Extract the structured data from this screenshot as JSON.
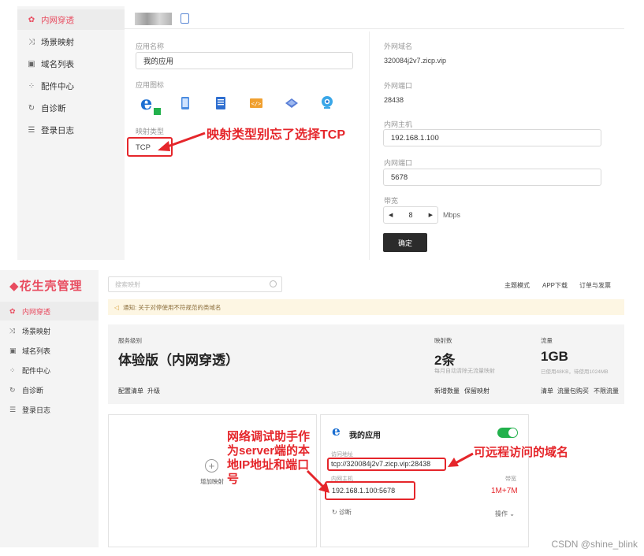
{
  "top": {
    "sidebar": [
      {
        "label": "内网穿透",
        "icon": "globe-icon",
        "active": true
      },
      {
        "label": "场景映射",
        "icon": "scenario-icon",
        "active": false
      },
      {
        "label": "域名列表",
        "icon": "domain-list-icon",
        "active": false
      },
      {
        "label": "配件中心",
        "icon": "parts-icon",
        "active": false
      },
      {
        "label": "自诊断",
        "icon": "diagnose-icon",
        "active": false
      },
      {
        "label": "登录日志",
        "icon": "log-icon",
        "active": false
      }
    ],
    "form": {
      "app_name_label": "应用名称",
      "app_name_value": "我的应用",
      "app_icon_label": "应用图标",
      "map_type_label": "映射类型",
      "map_type_value": "TCP",
      "ext_domain_label": "外网域名",
      "ext_domain_value": "320084j2v7.zicp.vip",
      "ext_port_label": "外网端口",
      "ext_port_value": "28438",
      "int_host_label": "内网主机",
      "int_host_value": "192.168.1.100",
      "int_port_label": "内网端口",
      "int_port_value": "5678",
      "bandwidth_label": "带宽",
      "bandwidth_value": "8",
      "bandwidth_unit": "Mbps",
      "confirm_label": "确定"
    },
    "annotation": "映射类型别忘了选择TCP"
  },
  "bottom": {
    "logo": "花生壳管理",
    "sidebar": [
      {
        "label": "内网穿透",
        "icon": "globe-icon",
        "active": true
      },
      {
        "label": "场景映射",
        "icon": "scenario-icon",
        "active": false
      },
      {
        "label": "域名列表",
        "icon": "domain-list-icon",
        "active": false
      },
      {
        "label": "配件中心",
        "icon": "parts-icon",
        "active": false
      },
      {
        "label": "自诊断",
        "icon": "diagnose-icon",
        "active": false
      },
      {
        "label": "登录日志",
        "icon": "log-icon",
        "active": false
      }
    ],
    "search_placeholder": "搜索映射",
    "top_menu": [
      "主题模式",
      "APP下载",
      "订单与发票"
    ],
    "notice": "通知: 关于对停使用不符规范的类域名",
    "plan": {
      "service_label": "服务级别",
      "service_value": "体验版（内网穿透）",
      "config_link": "配置清单",
      "upgrade_link": "升级",
      "map_count_label": "映射数",
      "map_count_value": "2条",
      "map_count_note": "每月自动清除无流量映射",
      "map_add": "新增数量",
      "map_keep": "保留映射",
      "traffic_label": "流量",
      "traffic_value": "1GB",
      "traffic_note": "已使用48KB，待使用1024MB",
      "traffic_detail": "清单",
      "traffic_pack": "流量包购买",
      "traffic_unlimited": "不限流量"
    },
    "add_mapping": "增加映射",
    "app_card": {
      "title": "我的应用",
      "access_label": "访问地址",
      "access_value": "tcp://320084j2v7.zicp.vip:28438",
      "host_label": "内网主机",
      "host_value": "192.168.1.100:5678",
      "bw_label": "带宽",
      "bw_base": "1M",
      "bw_extra": "+7M",
      "diagnose": "诊断",
      "operate": "操作"
    },
    "annotations": {
      "server_note": "网络调试助手作为server端的本地IP地址和端口号",
      "domain_note": "可远程访问的域名"
    }
  },
  "watermark": "CSDN @shine_blink",
  "colors": {
    "accent": "#e84b5f",
    "annotation_red": "#e5262b",
    "toggle_green": "#22b14c"
  }
}
